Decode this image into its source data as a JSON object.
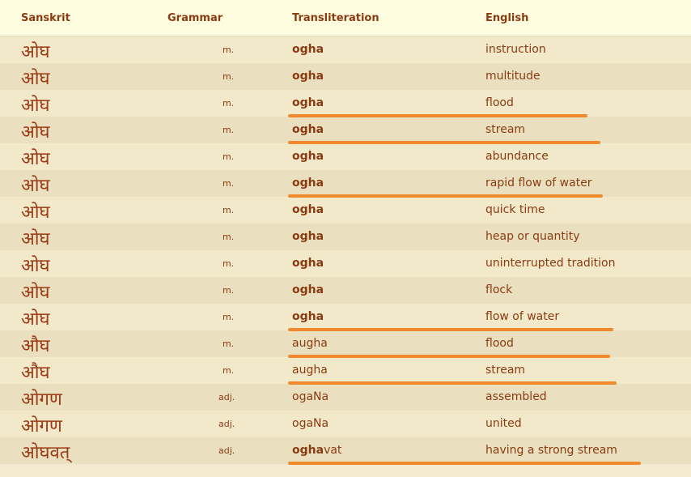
{
  "headers": {
    "sanskrit": "Sanskrit",
    "grammar": "Grammar",
    "transliteration": "Transliteration",
    "english": "English"
  },
  "rows": [
    {
      "sanskrit": "ओघ",
      "grammar": "m.",
      "translit_bold": "ogha",
      "translit_rest": "",
      "english": "instruction"
    },
    {
      "sanskrit": "ओघ",
      "grammar": "m.",
      "translit_bold": "ogha",
      "translit_rest": "",
      "english": "multitude"
    },
    {
      "sanskrit": "ओघ",
      "grammar": "m.",
      "translit_bold": "ogha",
      "translit_rest": "",
      "english": "flood"
    },
    {
      "sanskrit": "ओघ",
      "grammar": "m.",
      "translit_bold": "ogha",
      "translit_rest": "",
      "english": "stream"
    },
    {
      "sanskrit": "ओघ",
      "grammar": "m.",
      "translit_bold": "ogha",
      "translit_rest": "",
      "english": "abundance"
    },
    {
      "sanskrit": "ओघ",
      "grammar": "m.",
      "translit_bold": "ogha",
      "translit_rest": "",
      "english": "rapid flow of water"
    },
    {
      "sanskrit": "ओघ",
      "grammar": "m.",
      "translit_bold": "ogha",
      "translit_rest": "",
      "english": "quick time"
    },
    {
      "sanskrit": "ओघ",
      "grammar": "m.",
      "translit_bold": "ogha",
      "translit_rest": "",
      "english": "heap or quantity"
    },
    {
      "sanskrit": "ओघ",
      "grammar": "m.",
      "translit_bold": "ogha",
      "translit_rest": "",
      "english": "uninterrupted tradition"
    },
    {
      "sanskrit": "ओघ",
      "grammar": "m.",
      "translit_bold": "ogha",
      "translit_rest": "",
      "english": "flock"
    },
    {
      "sanskrit": "ओघ",
      "grammar": "m.",
      "translit_bold": "ogha",
      "translit_rest": "",
      "english": "flow of water"
    },
    {
      "sanskrit": "औघ",
      "grammar": "m.",
      "translit_bold": "",
      "translit_rest": "augha",
      "english": "flood"
    },
    {
      "sanskrit": "औघ",
      "grammar": "m.",
      "translit_bold": "",
      "translit_rest": "augha",
      "english": "stream"
    },
    {
      "sanskrit": "ओगण",
      "grammar": "adj.",
      "translit_bold": "",
      "translit_rest": "ogaNa",
      "english": "assembled"
    },
    {
      "sanskrit": "ओगण",
      "grammar": "adj.",
      "translit_bold": "",
      "translit_rest": "ogaNa",
      "english": "united"
    },
    {
      "sanskrit": "ओघवत्",
      "grammar": "adj.",
      "translit_bold": "ogha",
      "translit_rest": "vat",
      "english": "having a strong stream"
    }
  ],
  "highlight_color": "#f08a2c"
}
